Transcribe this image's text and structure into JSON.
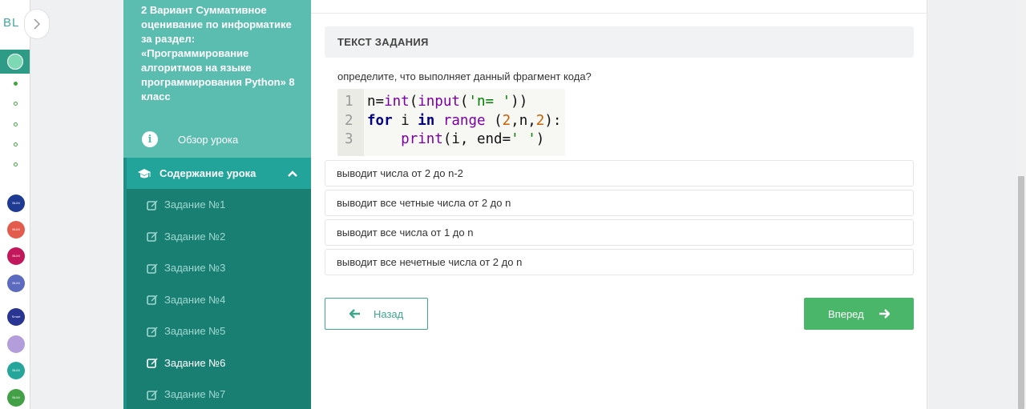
{
  "rail": {
    "logo": "BL",
    "apps": [
      {
        "name": "app-1",
        "color": "#1f3a93",
        "label": "BLIM"
      },
      {
        "name": "app-2",
        "color": "#e25b4c",
        "label": "BLIM"
      },
      {
        "name": "app-3",
        "color": "#c2185b",
        "label": "BLIM"
      },
      {
        "name": "app-4",
        "color": "#5c6bc0",
        "label": "BLIM"
      },
      {
        "name": "app-5",
        "color": "#283593",
        "label": "Smart"
      },
      {
        "name": "app-6",
        "color": "#b39ddb",
        "label": ""
      },
      {
        "name": "app-7",
        "color": "#26a69a",
        "label": "BLIM"
      },
      {
        "name": "app-8",
        "color": "#43a047",
        "label": "BLIM"
      }
    ]
  },
  "lesson": {
    "title": "2 Вариант Суммативное оценивание по информатике за раздел: «Программирование алгоритмов на языке программирования Python» 8 класс",
    "overview_label": "Обзор урока",
    "contents_label": "Содержание урока",
    "tasks": [
      "Задание №1",
      "Задание №2",
      "Задание №3",
      "Задание №4",
      "Задание №5",
      "Задание №6",
      "Задание №7"
    ],
    "active_task": "Задание №6"
  },
  "main": {
    "header": "ТЕКСТ ЗАДАНИЯ",
    "question": "определите, что выполняет данный фрагмент кода?",
    "code": {
      "line_numbers": [
        "1",
        "2",
        "3"
      ]
    },
    "options": [
      "выводит числа от 2 до n-2",
      "выводит все четные числа от 2 до n",
      "выводит все числа от 1 до n",
      "выводит все нечетные числа от 2 до n"
    ],
    "back_label": "Назад",
    "next_label": "Вперед"
  },
  "colors": {
    "accent_green": "#4ab66a",
    "sidebar_teal": "#1f8f85",
    "sidebar_head": "#5bbcb0"
  }
}
